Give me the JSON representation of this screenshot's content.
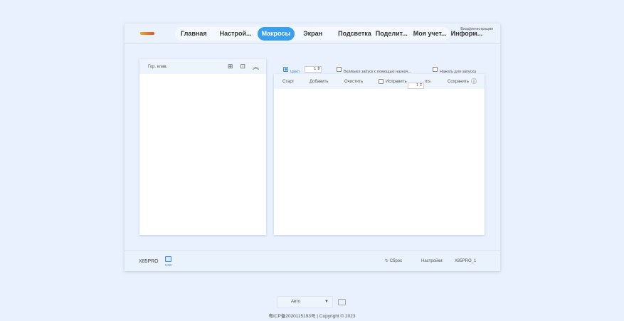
{
  "header": {
    "nav": [
      "Главная",
      "Настрой...",
      "Макросы",
      "Экран",
      "Подсветка",
      "Поделит...",
      "Моя учет...",
      "Информ..."
    ],
    "active": "Макросы",
    "login": "Вход/регистрация"
  },
  "left_panel": {
    "title": "Гор. клав."
  },
  "controls": {
    "cycle_label": "Цикл",
    "cycle_value": "1",
    "toggle_label": "Вкл/выкл запуск с помощью назнач...",
    "press_label": "Нажать для запуска"
  },
  "macro_toolbar": {
    "start": "Старт",
    "add": "Добавить",
    "clear": "Очистить",
    "fix": "Исправить",
    "fix_value": "1",
    "unit": "ms",
    "save": "Сохранить"
  },
  "footer": {
    "device": "X85PRO",
    "usb": "USB",
    "reset": "Сброс",
    "settings_label": "Настройки:",
    "settings_value": "X85PRO_1"
  },
  "bottom": {
    "mode": "Авто",
    "copyright": "粤ICP备2020115193号 | Copyright © 2023"
  },
  "colors": {
    "accent": "#3aa0ee",
    "background": "#e8f1fd"
  }
}
